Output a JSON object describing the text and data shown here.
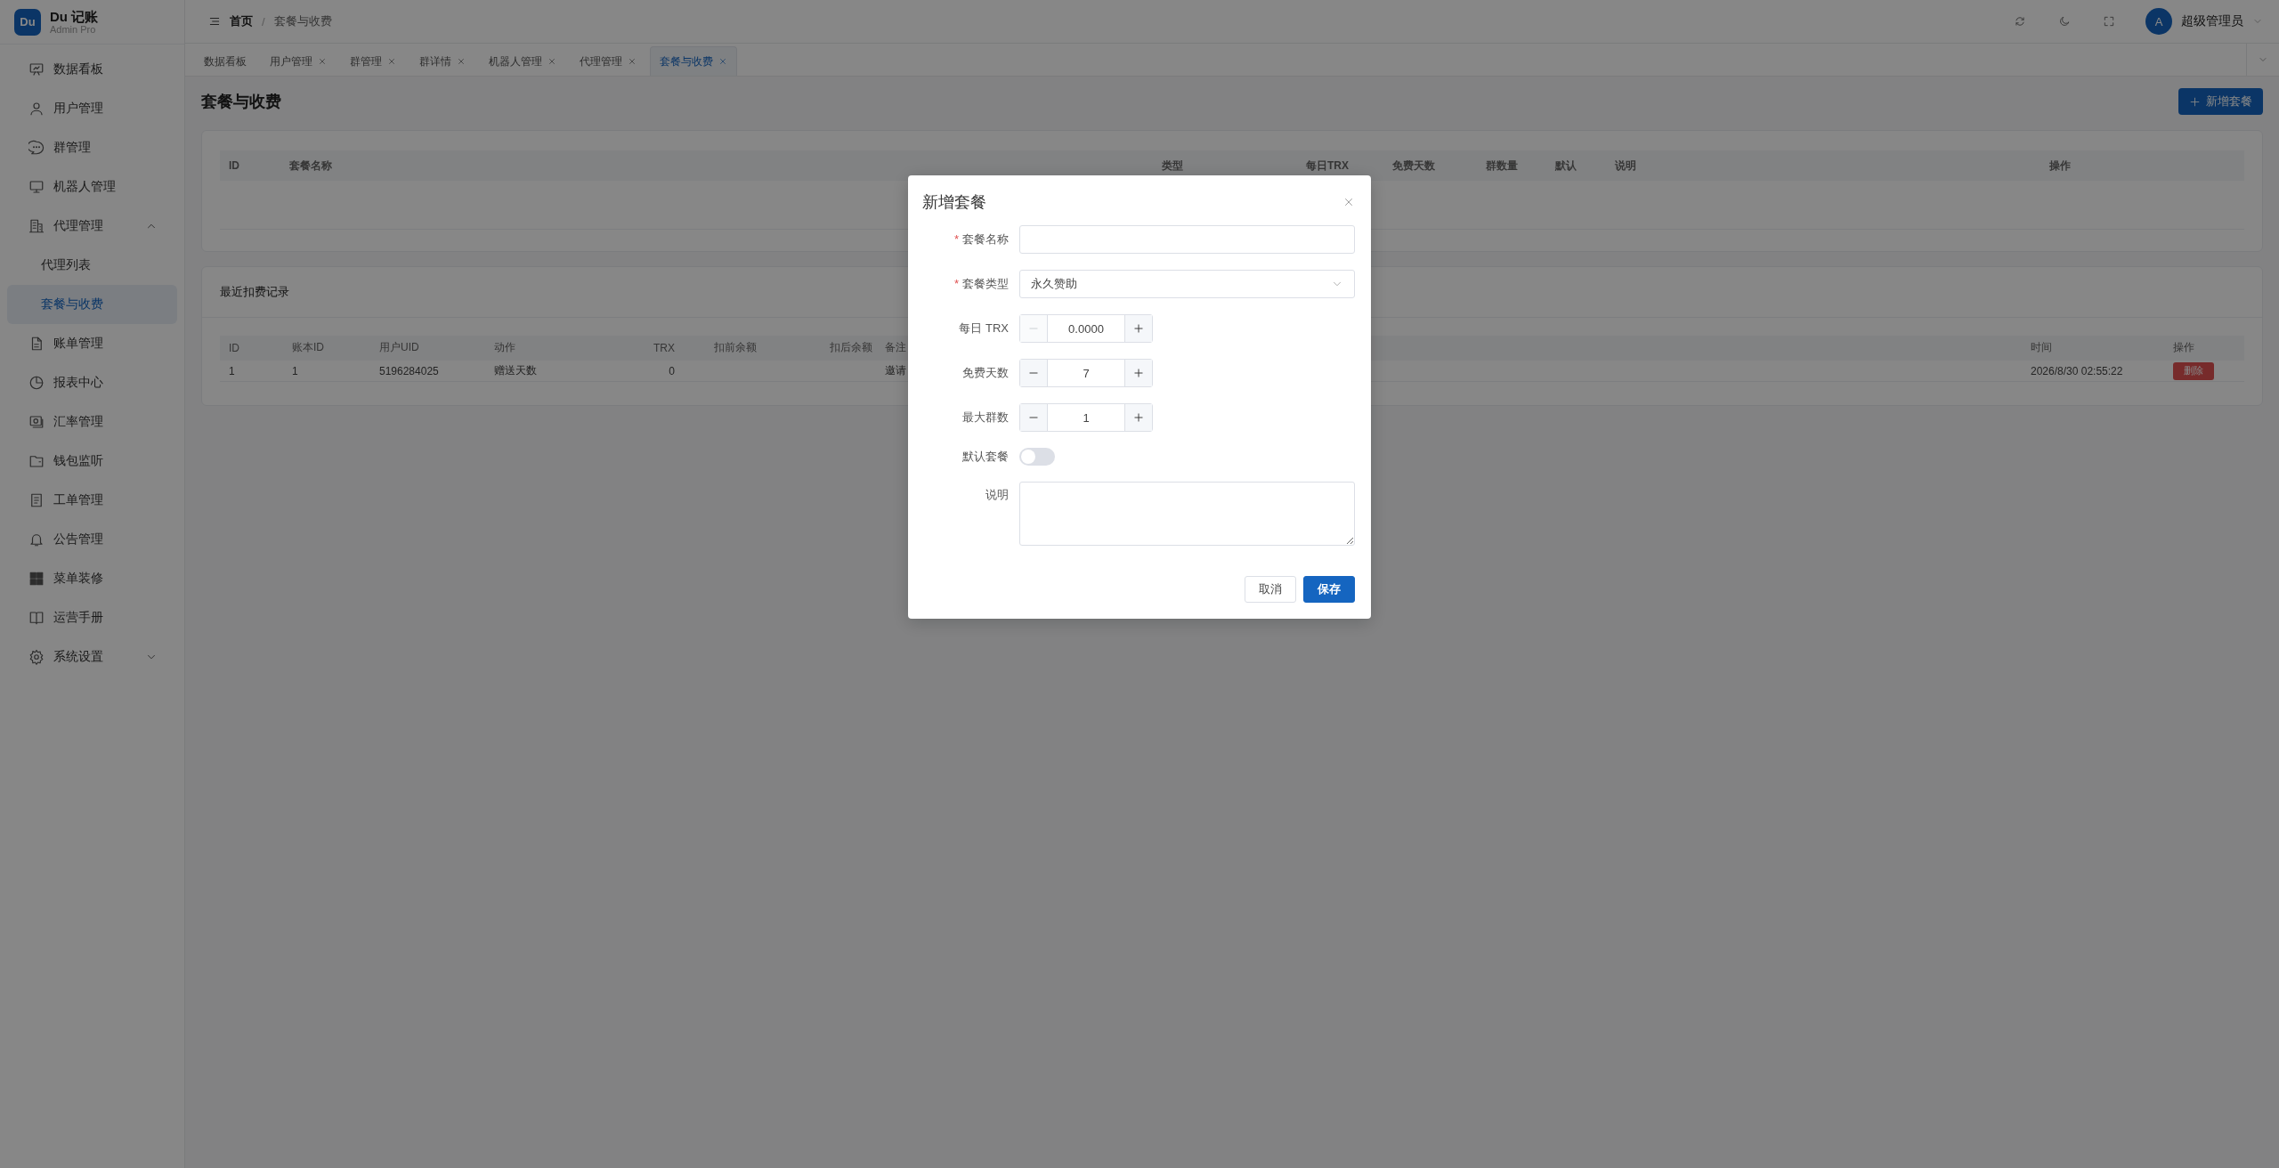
{
  "brand": {
    "logo": "Du",
    "name": "Du 记账",
    "subtitle": "Admin Pro"
  },
  "sidebar": {
    "items": [
      {
        "label": "数据看板",
        "selected": false
      },
      {
        "label": "用户管理",
        "selected": false
      },
      {
        "label": "群管理",
        "selected": false
      },
      {
        "label": "机器人管理",
        "selected": false
      },
      {
        "label": "代理管理",
        "expanded": true,
        "children": [
          {
            "label": "代理列表",
            "selected": false
          },
          {
            "label": "套餐与收费",
            "selected": true
          }
        ]
      },
      {
        "label": "账单管理",
        "selected": false
      },
      {
        "label": "报表中心",
        "selected": false
      },
      {
        "label": "汇率管理",
        "selected": false
      },
      {
        "label": "钱包监听",
        "selected": false
      },
      {
        "label": "工单管理",
        "selected": false
      },
      {
        "label": "公告管理",
        "selected": false
      },
      {
        "label": "菜单装修",
        "selected": false
      },
      {
        "label": "运营手册",
        "selected": false
      },
      {
        "label": "系统设置",
        "expanded": false
      }
    ]
  },
  "header": {
    "breadcrumb": [
      "首页",
      "套餐与收费"
    ],
    "separator": "/",
    "user": {
      "avatar": "A",
      "name": "超级管理员"
    }
  },
  "tabs": [
    {
      "label": "数据看板",
      "closable": false,
      "selected": false
    },
    {
      "label": "用户管理",
      "closable": true,
      "selected": false
    },
    {
      "label": "群管理",
      "closable": true,
      "selected": false
    },
    {
      "label": "群详情",
      "closable": true,
      "selected": false
    },
    {
      "label": "机器人管理",
      "closable": true,
      "selected": false
    },
    {
      "label": "代理管理",
      "closable": true,
      "selected": false
    },
    {
      "label": "套餐与收费",
      "closable": true,
      "selected": true
    }
  ],
  "page": {
    "title": "套餐与收费",
    "add_button": "新增套餐"
  },
  "plans_table": {
    "columns": [
      "ID",
      "套餐名称",
      "类型",
      "每日TRX",
      "免费天数",
      "群数量",
      "默认",
      "说明",
      "操作"
    ]
  },
  "records": {
    "title": "最近扣费记录",
    "columns": [
      "ID",
      "账本ID",
      "用户UID",
      "动作",
      "TRX",
      "扣前余额",
      "扣后余额",
      "备注",
      "时间",
      "操作"
    ],
    "rows": [
      {
        "id": "1",
        "ledger_id": "1",
        "user_uid": "5196284025",
        "action": "赠送天数",
        "trx": "0",
        "note": "邀请",
        "time": "2026/8/30 02:55:22",
        "delete_button": "删除"
      }
    ]
  },
  "modal": {
    "title": "新增套餐",
    "required_mark": "*",
    "fields": [
      {
        "kind": "text",
        "label": "套餐名称",
        "required": true
      },
      {
        "kind": "select",
        "label": "套餐类型",
        "required": true,
        "value": "永久赞助"
      },
      {
        "kind": "number",
        "label": "每日 TRX",
        "required": false,
        "value": "0.0000",
        "decrement_disabled": true
      },
      {
        "kind": "number",
        "label": "免费天数",
        "required": false,
        "value": "7",
        "decrement_disabled": false
      },
      {
        "kind": "number",
        "label": "最大群数",
        "required": false,
        "value": "1",
        "decrement_disabled": false
      },
      {
        "kind": "switch",
        "label": "默认套餐",
        "required": false,
        "on": false
      },
      {
        "kind": "textarea",
        "label": "说明",
        "required": false
      }
    ],
    "cancel_button": "取消",
    "save_button": "保存"
  }
}
